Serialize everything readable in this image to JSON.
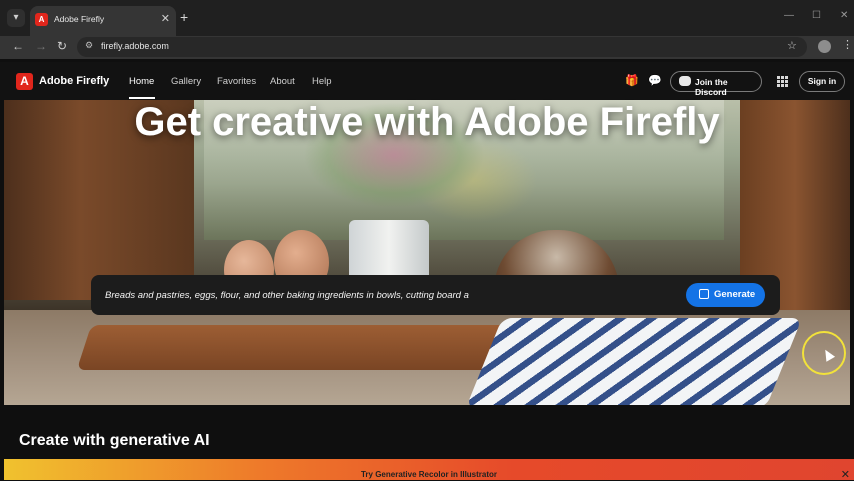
{
  "browser": {
    "tab_title": "Adobe Firefly",
    "url": "firefly.adobe.com",
    "new_tab_label": "+",
    "close_tab_label": "✕",
    "window_controls": [
      "—",
      "☐",
      "✕"
    ]
  },
  "site": {
    "brand": "Adobe Firefly",
    "nav": [
      "Home",
      "Gallery",
      "Favorites",
      "About",
      "Help"
    ],
    "active_nav": "Home",
    "discord_button": "Join the Discord",
    "signin_button": "Sign in"
  },
  "hero": {
    "title": "Get creative with Adobe Firefly",
    "prompt_value": "Breads and pastries, eggs, flour, and other baking ingredients in bowls, cutting board a",
    "generate_button": "Generate"
  },
  "section": {
    "title": "Create with generative AI"
  },
  "promo": {
    "text": "Try Generative Recolor in Illustrator",
    "close": "✕"
  },
  "colors": {
    "accent": "#1473e6",
    "brand_red": "#e1261c",
    "cursor_highlight": "#f2e23a"
  }
}
